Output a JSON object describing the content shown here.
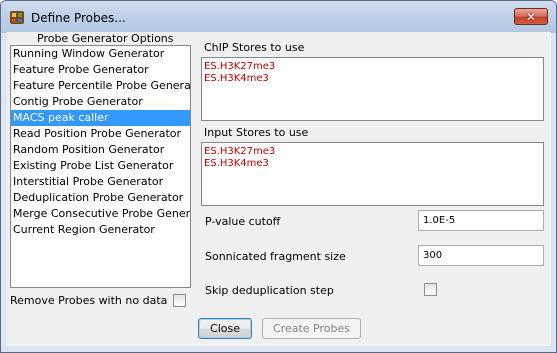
{
  "window": {
    "title": "Define Probes...",
    "close_glyph": "✕",
    "icon": "probe-app-icon"
  },
  "generators": {
    "heading": "Probe Generator Options",
    "items": [
      "Running Window Generator",
      "Feature Probe Generator",
      "Feature Percentile Probe Generator",
      "Contig Probe Generator",
      "MACS peak caller",
      "Read Position Probe Generator",
      "Random Position Generator",
      "Existing Probe List Generator",
      "Interstitial Probe Generator",
      "Deduplication Probe Generator",
      "Merge Consecutive Probe Generator",
      "Current Region Generator"
    ],
    "selected": "MACS peak caller"
  },
  "remove_empty": {
    "label": "Remove Probes with no data",
    "checked": false
  },
  "chip_stores": {
    "label": "ChIP Stores to use",
    "items": [
      "ES.H3K27me3",
      "ES.H3K4me3"
    ]
  },
  "input_stores": {
    "label": "Input Stores to use",
    "items": [
      "ES.H3K27me3",
      "ES.H3K4me3"
    ]
  },
  "pvalue": {
    "label": "P-value cutoff",
    "value": "1.0E-5"
  },
  "fragment": {
    "label": "Sonnicated fragment size",
    "value": "300"
  },
  "skip_dedup": {
    "label": "Skip deduplication step",
    "checked": false
  },
  "buttons": {
    "close": "Close",
    "create": "Create Probes"
  },
  "colors": {
    "selection": "#3399ff",
    "store_text": "#c00000",
    "close_button": "#c0432d"
  }
}
